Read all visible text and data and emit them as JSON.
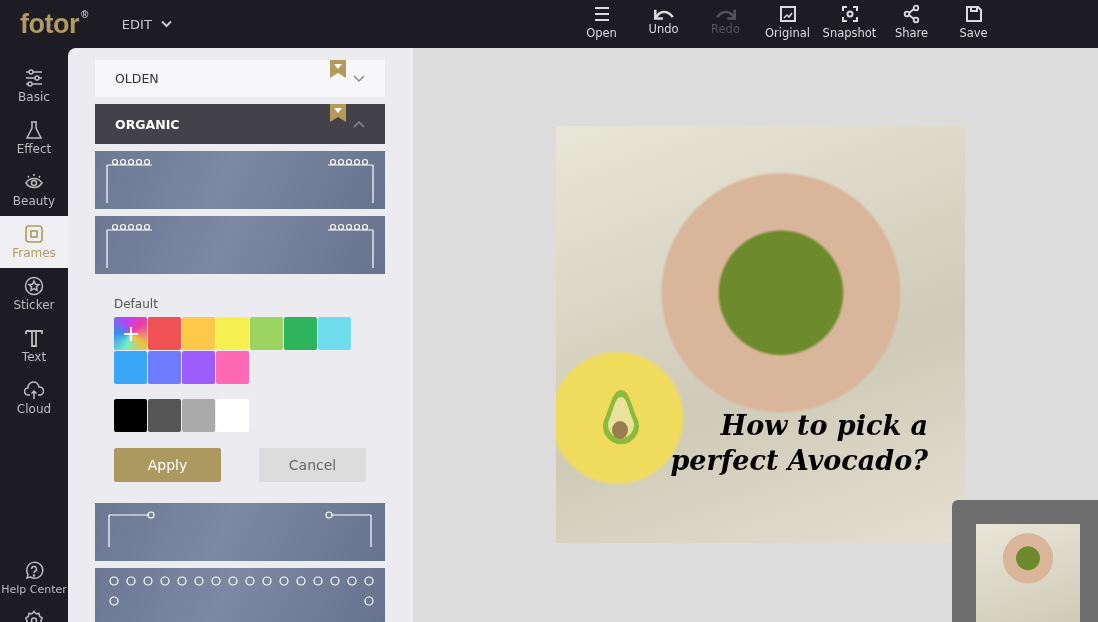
{
  "app": {
    "logo": "fotor",
    "logo_mark": "®",
    "mode_menu": "EDIT"
  },
  "toolbar": [
    {
      "label": "Open",
      "kind": "menu",
      "disabled": false
    },
    {
      "label": "Undo",
      "kind": "undo",
      "disabled": false
    },
    {
      "label": "Redo",
      "kind": "redo",
      "disabled": true
    },
    {
      "label": "Original",
      "kind": "original",
      "disabled": false
    },
    {
      "label": "Snapshot",
      "kind": "snapshot",
      "disabled": false
    },
    {
      "label": "Share",
      "kind": "share",
      "disabled": false
    },
    {
      "label": "Save",
      "kind": "save",
      "disabled": false
    }
  ],
  "sidebar": {
    "items": [
      {
        "label": "Basic",
        "kind": "sliders",
        "selected": false
      },
      {
        "label": "Effect",
        "kind": "flask",
        "selected": false
      },
      {
        "label": "Beauty",
        "kind": "eye",
        "selected": false
      },
      {
        "label": "Frames",
        "kind": "frame",
        "selected": true
      },
      {
        "label": "Sticker",
        "kind": "star",
        "selected": false
      },
      {
        "label": "Text",
        "kind": "text",
        "selected": false
      },
      {
        "label": "Cloud",
        "kind": "cloud",
        "selected": false
      }
    ],
    "bottom": [
      {
        "label": "Help Center",
        "kind": "help"
      }
    ]
  },
  "panel": {
    "categories": [
      {
        "label": "OLDEN",
        "expanded": false
      },
      {
        "label": "ORGANIC",
        "expanded": true
      }
    ],
    "color_group_label": "Default",
    "colors": [
      {
        "color": "#f05154"
      },
      {
        "color": "#fdc94b"
      },
      {
        "color": "#f7f051"
      },
      {
        "color": "#9bd460"
      },
      {
        "color": "#2eb45d"
      },
      {
        "color": "#6fdcee"
      },
      {
        "color": "#39a6f7"
      },
      {
        "color": "#6e7bfd"
      },
      {
        "color": "#9d5cfb"
      },
      {
        "color": "#fe69b5"
      }
    ],
    "grays": [
      {
        "color": "#000000"
      },
      {
        "color": "#555555"
      },
      {
        "color": "#aaaaaa"
      },
      {
        "color": "#ffffff"
      }
    ],
    "apply_button": "Apply",
    "cancel_button": "Cancel"
  },
  "canvas": {
    "headline_lines": [
      "How to pick a",
      "perfect Avocado?"
    ]
  }
}
